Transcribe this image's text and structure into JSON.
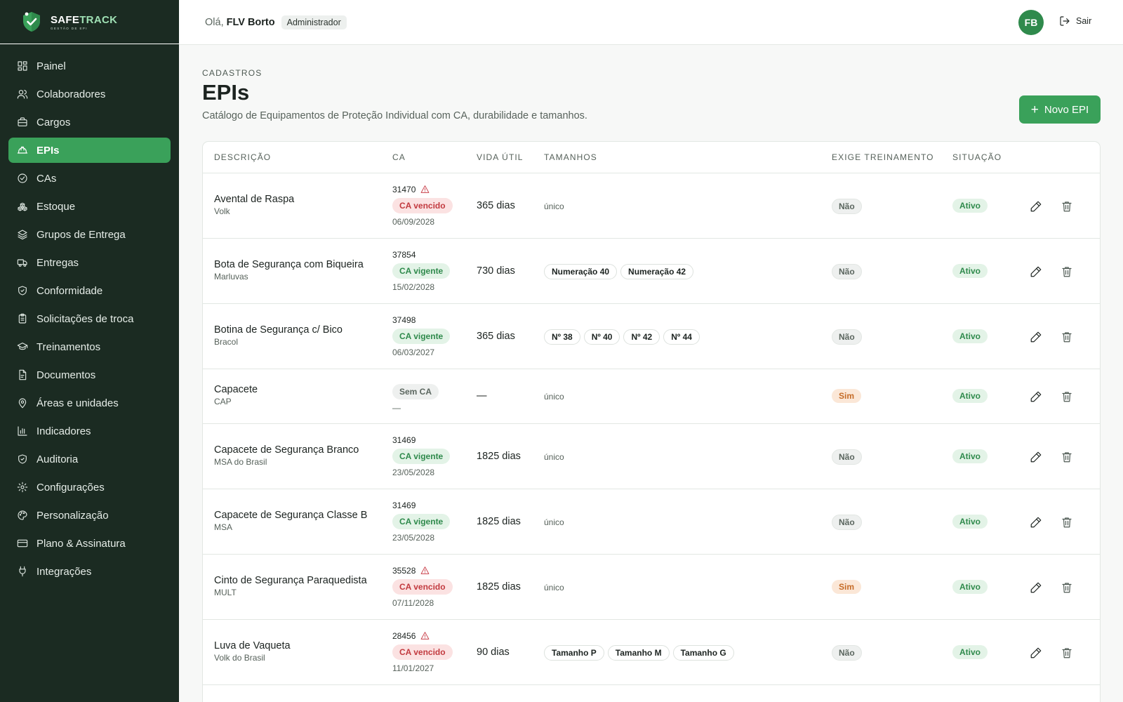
{
  "brand": {
    "name_prefix": "SAFE",
    "name_suffix": "TRACK",
    "subtitle": "GESTÃO DE EPI"
  },
  "sidebar": {
    "items": [
      {
        "label": "Painel",
        "icon": "grid-icon"
      },
      {
        "label": "Colaboradores",
        "icon": "users-icon"
      },
      {
        "label": "Cargos",
        "icon": "briefcase-icon"
      },
      {
        "label": "EPIs",
        "icon": "hardhat-icon",
        "active": true
      },
      {
        "label": "CAs",
        "icon": "check-circle-icon"
      },
      {
        "label": "Estoque",
        "icon": "boxes-icon"
      },
      {
        "label": "Grupos de Entrega",
        "icon": "layers-icon"
      },
      {
        "label": "Entregas",
        "icon": "truck-icon"
      },
      {
        "label": "Conformidade",
        "icon": "shield-check-icon"
      },
      {
        "label": "Solicitações de troca",
        "icon": "clipboard-icon"
      },
      {
        "label": "Treinamentos",
        "icon": "graduation-cap-icon"
      },
      {
        "label": "Documentos",
        "icon": "file-icon"
      },
      {
        "label": "Áreas e unidades",
        "icon": "map-pin-icon"
      },
      {
        "label": "Indicadores",
        "icon": "bar-chart-icon"
      },
      {
        "label": "Auditoria",
        "icon": "shield-icon"
      },
      {
        "label": "Configurações",
        "icon": "gear-icon"
      },
      {
        "label": "Personalização",
        "icon": "palette-icon"
      },
      {
        "label": "Plano & Assinatura",
        "icon": "credit-card-icon"
      },
      {
        "label": "Integrações",
        "icon": "plug-icon"
      }
    ]
  },
  "topbar": {
    "greeting": "Olá,",
    "user_name": "FLV Borto",
    "role": "Administrador",
    "avatar_initials": "FB",
    "logout_label": "Sair"
  },
  "page": {
    "section": "CADASTROS",
    "title": "EPIs",
    "description": "Catálogo de Equipamentos de Proteção Individual com CA, durabilidade e tamanhos.",
    "new_button": "Novo EPI"
  },
  "table": {
    "headers": {
      "descricao": "DESCRIÇÃO",
      "ca": "CA",
      "vida": "VIDA ÚTIL",
      "tamanhos": "TAMANHOS",
      "treinamento": "EXIGE TREINAMENTO",
      "situacao": "SITUAÇÃO"
    },
    "rows": [
      {
        "name": "Avental de Raspa",
        "brand": "Volk",
        "ca_number": "31470",
        "ca_warning": true,
        "ca_status": "CA vencido",
        "ca_kind": "vencido",
        "ca_date": "06/09/2028",
        "vida": "365 dias",
        "sizes": [],
        "sizes_text": "único",
        "training": "Não",
        "status": "Ativo"
      },
      {
        "name": "Bota de Segurança com Biqueira",
        "brand": "Marluvas",
        "ca_number": "37854",
        "ca_warning": false,
        "ca_status": "CA vigente",
        "ca_kind": "vigente",
        "ca_date": "15/02/2028",
        "vida": "730 dias",
        "sizes": [
          "Numeração 40",
          "Numeração 42"
        ],
        "sizes_text": "",
        "training": "Não",
        "status": "Ativo"
      },
      {
        "name": "Botina de Segurança c/ Bico",
        "brand": "Bracol",
        "ca_number": "37498",
        "ca_warning": false,
        "ca_status": "CA vigente",
        "ca_kind": "vigente",
        "ca_date": "06/03/2027",
        "vida": "365 dias",
        "sizes": [
          "Nº 38",
          "Nº 40",
          "Nº 42",
          "Nº 44"
        ],
        "sizes_text": "",
        "training": "Não",
        "status": "Ativo"
      },
      {
        "name": "Capacete",
        "brand": "CAP",
        "ca_number": "",
        "ca_warning": false,
        "ca_status": "Sem CA",
        "ca_kind": "sem",
        "ca_date": "—",
        "vida": "—",
        "sizes": [],
        "sizes_text": "único",
        "training": "Sim",
        "status": "Ativo"
      },
      {
        "name": "Capacete de Segurança Branco",
        "brand": "MSA do Brasil",
        "ca_number": "31469",
        "ca_warning": false,
        "ca_status": "CA vigente",
        "ca_kind": "vigente",
        "ca_date": "23/05/2028",
        "vida": "1825 dias",
        "sizes": [],
        "sizes_text": "único",
        "training": "Não",
        "status": "Ativo"
      },
      {
        "name": "Capacete de Segurança Classe B",
        "brand": "MSA",
        "ca_number": "31469",
        "ca_warning": false,
        "ca_status": "CA vigente",
        "ca_kind": "vigente",
        "ca_date": "23/05/2028",
        "vida": "1825 dias",
        "sizes": [],
        "sizes_text": "único",
        "training": "Não",
        "status": "Ativo"
      },
      {
        "name": "Cinto de Segurança Paraquedista",
        "brand": "MULT",
        "ca_number": "35528",
        "ca_warning": true,
        "ca_status": "CA vencido",
        "ca_kind": "vencido",
        "ca_date": "07/11/2028",
        "vida": "1825 dias",
        "sizes": [],
        "sizes_text": "único",
        "training": "Sim",
        "status": "Ativo"
      },
      {
        "name": "Luva de Vaqueta",
        "brand": "Volk do Brasil",
        "ca_number": "28456",
        "ca_warning": true,
        "ca_status": "CA vencido",
        "ca_kind": "vencido",
        "ca_date": "11/01/2027",
        "vida": "90 dias",
        "sizes": [
          "Tamanho P",
          "Tamanho M",
          "Tamanho G"
        ],
        "sizes_text": "",
        "training": "Não",
        "status": "Ativo"
      }
    ]
  },
  "colors": {
    "sidebar_bg": "#1b2b22",
    "accent": "#3aa15a",
    "danger": "#c23a3f",
    "warning": "#c56b27"
  }
}
